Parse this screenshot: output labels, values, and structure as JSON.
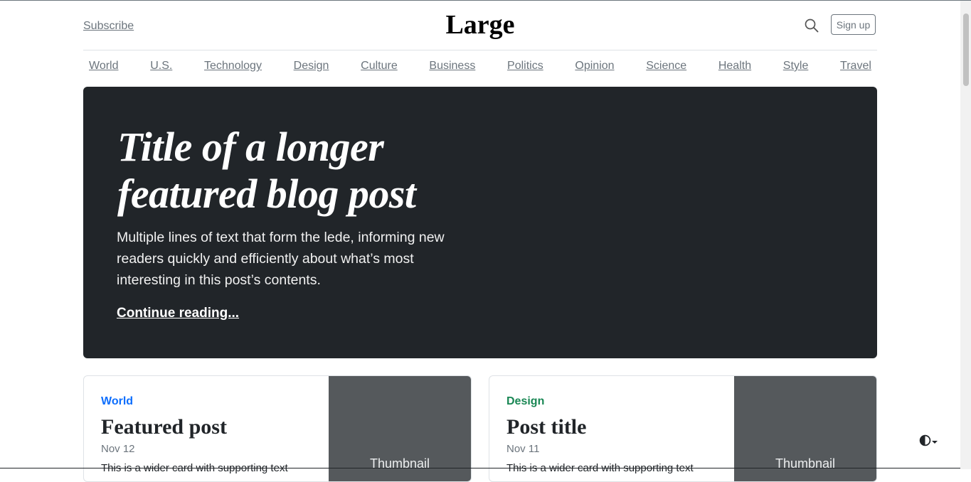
{
  "header": {
    "subscribe": "Subscribe",
    "brand": "Large",
    "signup": "Sign up",
    "search_icon": "search-icon"
  },
  "nav": {
    "items": [
      "World",
      "U.S.",
      "Technology",
      "Design",
      "Culture",
      "Business",
      "Politics",
      "Opinion",
      "Science",
      "Health",
      "Style",
      "Travel"
    ]
  },
  "hero": {
    "title_line1": "Title of a longer",
    "title_line2": "featured blog post",
    "lede": "Multiple lines of text that form the lede, informing new readers quickly and efficiently about what’s most interesting in this post’s contents.",
    "link": "Continue reading..."
  },
  "cards": [
    {
      "category": "World",
      "category_color": "#0d6efd",
      "title": "Featured post",
      "date": "Nov 12",
      "text": "This is a wider card with supporting text",
      "thumbnail": "Thumbnail"
    },
    {
      "category": "Design",
      "category_color": "#198754",
      "title": "Post title",
      "date": "Nov 11",
      "text": "This is a wider card with supporting text",
      "thumbnail": "Thumbnail"
    }
  ],
  "theme_toggle_icon": "contrast-icon",
  "colors": {
    "hero_bg": "#212529",
    "thumb_bg": "#55595c",
    "muted": "#6c757d"
  }
}
